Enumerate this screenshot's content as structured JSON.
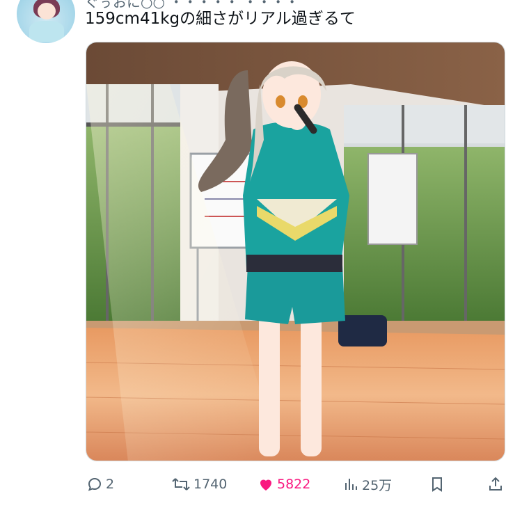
{
  "tweet": {
    "author_partial": "ぐぅおに○○ ・・・・・ ・・・・",
    "text": "159cm41kgの細さがリアル過ぎるて"
  },
  "media": {
    "alt_icon": "anime-girl-singing-in-dance-studio"
  },
  "actions": {
    "replies": "2",
    "retweets": "1740",
    "likes": "5822",
    "views": "25万"
  },
  "colors": {
    "like": "#f91880",
    "muted": "#536471",
    "text": "#0f1419"
  }
}
